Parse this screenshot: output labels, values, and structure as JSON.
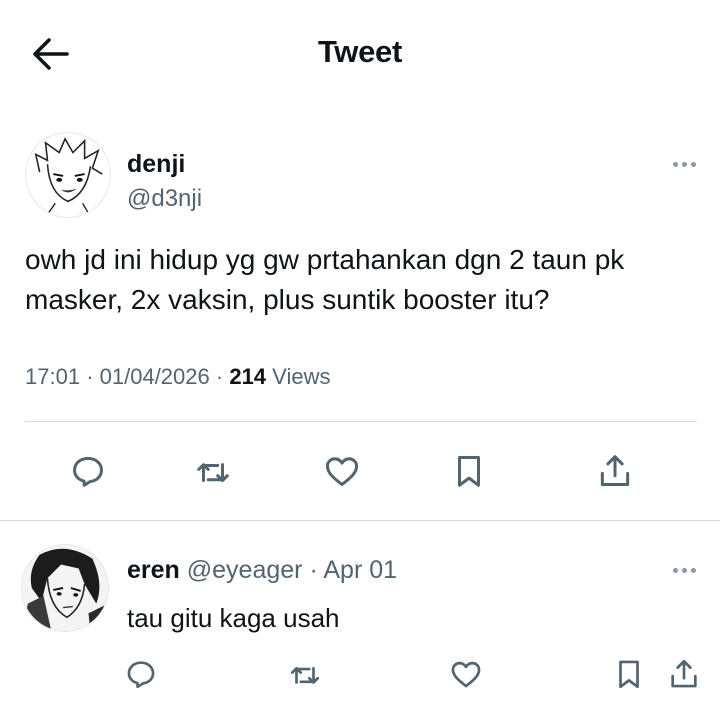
{
  "header": {
    "title": "Tweet",
    "back_icon": "arrow-left-icon"
  },
  "tweet": {
    "author_name": "denji",
    "author_handle": "@d3nji",
    "text": "owh jd ini hidup yg gw prtahankan dgn 2 taun pk masker, 2x vaksin, plus suntik booster itu?",
    "time": "17:01",
    "separator": "·",
    "date": "01/04/2026",
    "views_count": "214",
    "views_label": "Views",
    "actions": [
      "reply-icon",
      "retweet-icon",
      "like-icon",
      "bookmark-icon",
      "share-icon"
    ]
  },
  "reply": {
    "author_name": "eren",
    "author_handle": "@eyeager",
    "separator": "·",
    "date": "Apr 01",
    "text": "tau gitu kaga usah",
    "actions": [
      "reply-icon",
      "retweet-icon",
      "like-icon",
      "bookmark-icon",
      "share-icon"
    ]
  },
  "colors": {
    "text": "#0f1419",
    "secondary": "#536471",
    "divider": "#cfd9de"
  }
}
